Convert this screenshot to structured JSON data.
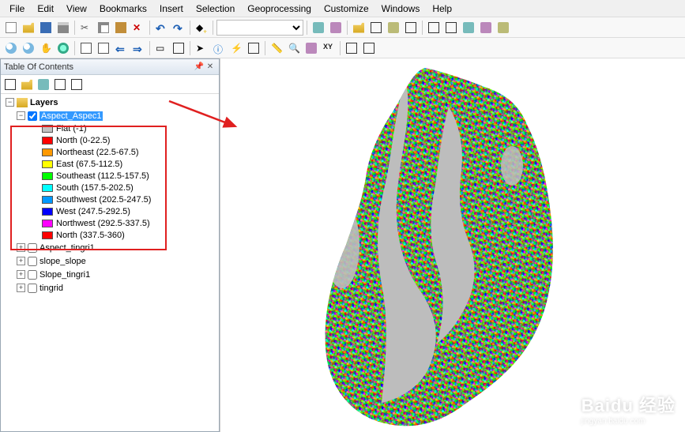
{
  "menu": [
    "File",
    "Edit",
    "View",
    "Bookmarks",
    "Insert",
    "Selection",
    "Geoprocessing",
    "Customize",
    "Windows",
    "Help"
  ],
  "toc": {
    "title": "Table Of Contents",
    "root": "Layers",
    "active_layer": "Aspect_Aspec1",
    "legend": [
      {
        "color": "#c2c2c2",
        "label": "Flat (-1)"
      },
      {
        "color": "#ff0000",
        "label": "North (0-22.5)"
      },
      {
        "color": "#ff9900",
        "label": "Northeast (22.5-67.5)"
      },
      {
        "color": "#ffff00",
        "label": "East (67.5-112.5)"
      },
      {
        "color": "#00ff00",
        "label": "Southeast (112.5-157.5)"
      },
      {
        "color": "#00ffff",
        "label": "South (157.5-202.5)"
      },
      {
        "color": "#0099ff",
        "label": "Southwest (202.5-247.5)"
      },
      {
        "color": "#0000ff",
        "label": "West (247.5-292.5)"
      },
      {
        "color": "#ff00ff",
        "label": "Northwest (292.5-337.5)"
      },
      {
        "color": "#ff0000",
        "label": "North (337.5-360)"
      }
    ],
    "other_layers": [
      "Aspect_tingri1",
      "slope_slope",
      "Slope_tingri1",
      "tingrid"
    ]
  },
  "watermark": {
    "brand": "Baidu 经验",
    "sub": "jingyan.baidu.com"
  },
  "scale_placeholder": ""
}
